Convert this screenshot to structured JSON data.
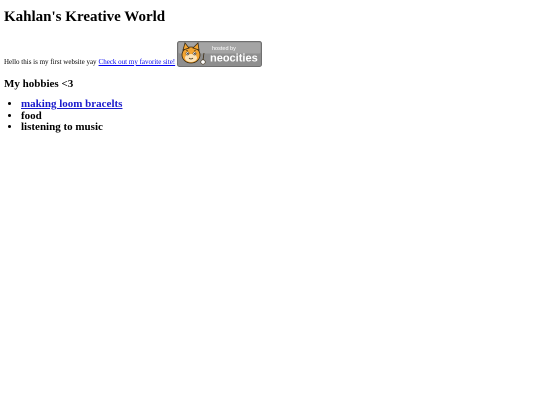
{
  "page": {
    "title": "Kahlan's Kreative World",
    "intro": {
      "text": "Hello this is my first website yay",
      "link_label": "Check out my favorite site!"
    },
    "badge": {
      "line1": "hosted by",
      "line2": "neocities"
    },
    "hobbies": {
      "heading": "My hobbies <3",
      "items": [
        {
          "label": "making loom bracelts",
          "is_link": true
        },
        {
          "label": "food",
          "is_link": false
        },
        {
          "label": "listening to music",
          "is_link": false
        }
      ]
    }
  },
  "colors": {
    "link": "#0000ee",
    "badge_bg": "#8e8e8e",
    "cat_orange": "#f3a533"
  }
}
